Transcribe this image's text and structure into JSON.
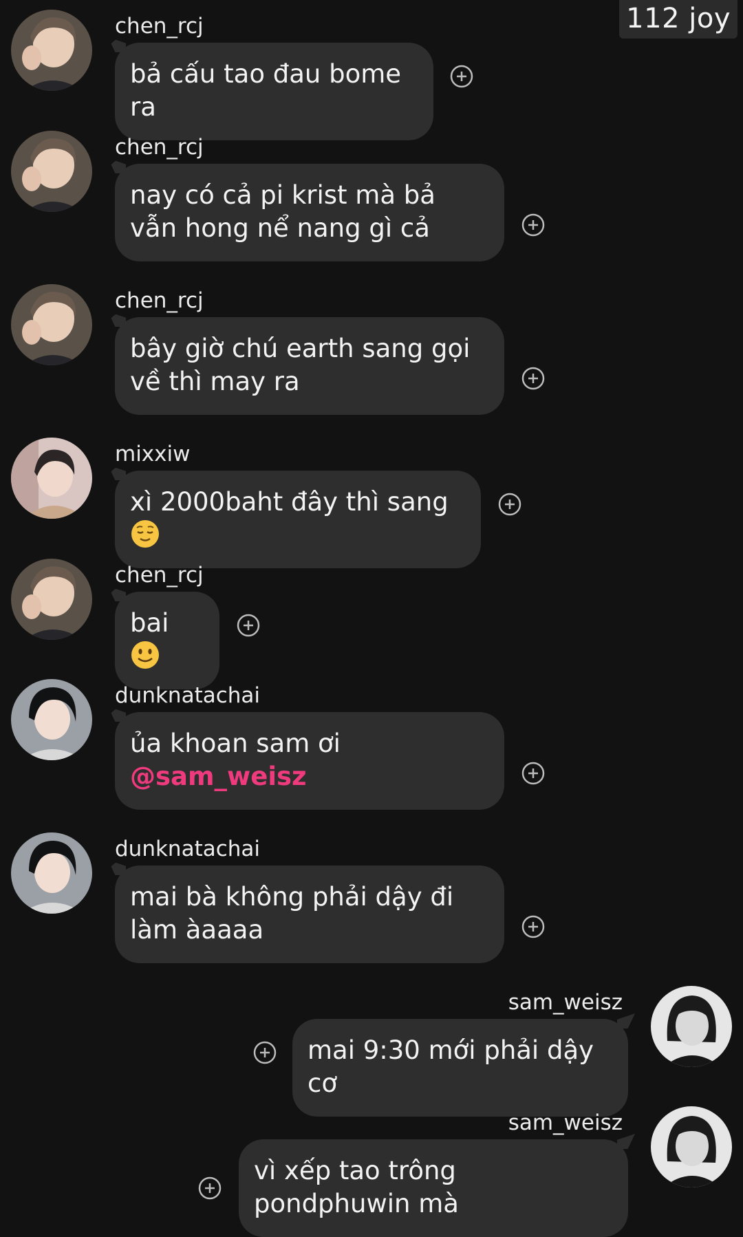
{
  "watermark": "112 joy",
  "messages": [
    {
      "username": "chen_rcj",
      "text": "bả cấu tao đau bome ra",
      "side": "left",
      "avatar": "chen-avatar"
    },
    {
      "username": "chen_rcj",
      "text": "nay có cả pi krist mà bả vẫn hong nể nang gì cả",
      "side": "left",
      "avatar": "chen-avatar"
    },
    {
      "username": "chen_rcj",
      "text": "bây giờ chú earth sang gọi về thì may ra",
      "side": "left",
      "avatar": "chen-avatar"
    },
    {
      "username": "mixxiw",
      "text": "xì 2000baht đây thì sang",
      "emoji": "relieved-face-emoji",
      "side": "left",
      "avatar": "mixxiw-avatar"
    },
    {
      "username": "chen_rcj",
      "text": "bai",
      "emoji": "slightly-smiling-face-emoji",
      "side": "left",
      "avatar": "chen-avatar"
    },
    {
      "username": "dunknatachai",
      "text": "ủa khoan sam ơi",
      "mention": "@sam_weisz",
      "side": "left",
      "avatar": "dunk-avatar"
    },
    {
      "username": "dunknatachai",
      "text": "mai bà không phải dậy đi làm àaaaa",
      "side": "left",
      "avatar": "dunk-avatar"
    },
    {
      "username": "sam_weisz",
      "text": "mai 9:30 mới phải dậy cơ",
      "side": "right",
      "avatar": "sam-avatar"
    },
    {
      "username": "sam_weisz",
      "text": "vì xếp tao trông pondphuwin mà",
      "side": "right",
      "avatar": "sam-avatar"
    }
  ],
  "icons": {
    "react": "add-reaction-icon"
  },
  "colors": {
    "background": "#121212",
    "bubble": "#2e2e2e",
    "mention": "#ef3b7d"
  }
}
